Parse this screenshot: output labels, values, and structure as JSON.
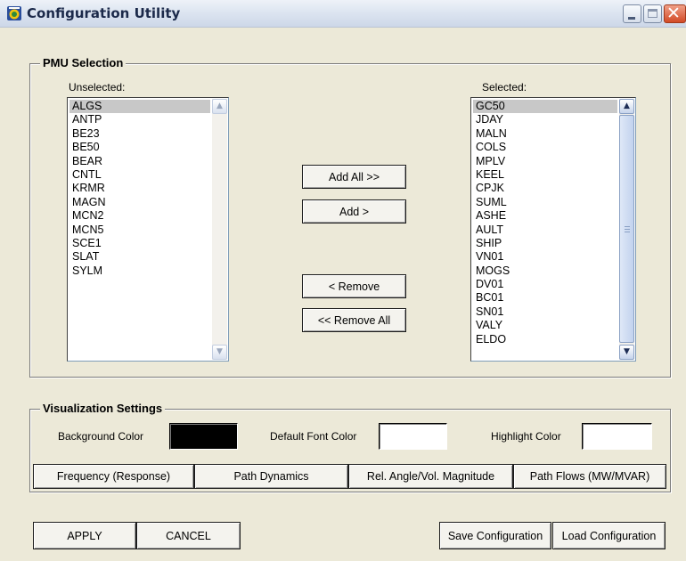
{
  "window": {
    "title": "Configuration Utility"
  },
  "pmu": {
    "legend": "PMU Selection",
    "unselected_label": "Unselected:",
    "selected_label": "Selected:",
    "unselected": [
      "ALGS",
      "ANTP",
      "BE23",
      "BE50",
      "BEAR",
      "CNTL",
      "KRMR",
      "MAGN",
      "MCN2",
      "MCN5",
      "SCE1",
      "SLAT",
      "SYLM"
    ],
    "selected": [
      "GC50",
      "JDAY",
      "MALN",
      "COLS",
      "MPLV",
      "KEEL",
      "CPJK",
      "SUML",
      "ASHE",
      "AULT",
      "SHIP",
      "VN01",
      "MOGS",
      "DV01",
      "BC01",
      "SN01",
      "VALY",
      "ELDO"
    ],
    "buttons": {
      "add_all": "Add All >>",
      "add": "Add >",
      "remove": "< Remove",
      "remove_all": "<< Remove All"
    }
  },
  "viz": {
    "legend": "Visualization Settings",
    "background_label": "Background Color",
    "font_label": "Default Font Color",
    "highlight_label": "Highlight Color",
    "colors": {
      "background": "#000000",
      "font": "#ffffff",
      "highlight": "#ffffff"
    },
    "tabs": [
      "Frequency (Response)",
      "Path Dynamics",
      "Rel. Angle/Vol. Magnitude",
      "Path Flows (MW/MVAR)"
    ]
  },
  "footer": {
    "apply": "APPLY",
    "cancel": "CANCEL",
    "save": "Save Configuration",
    "load": "Load Configuration"
  }
}
